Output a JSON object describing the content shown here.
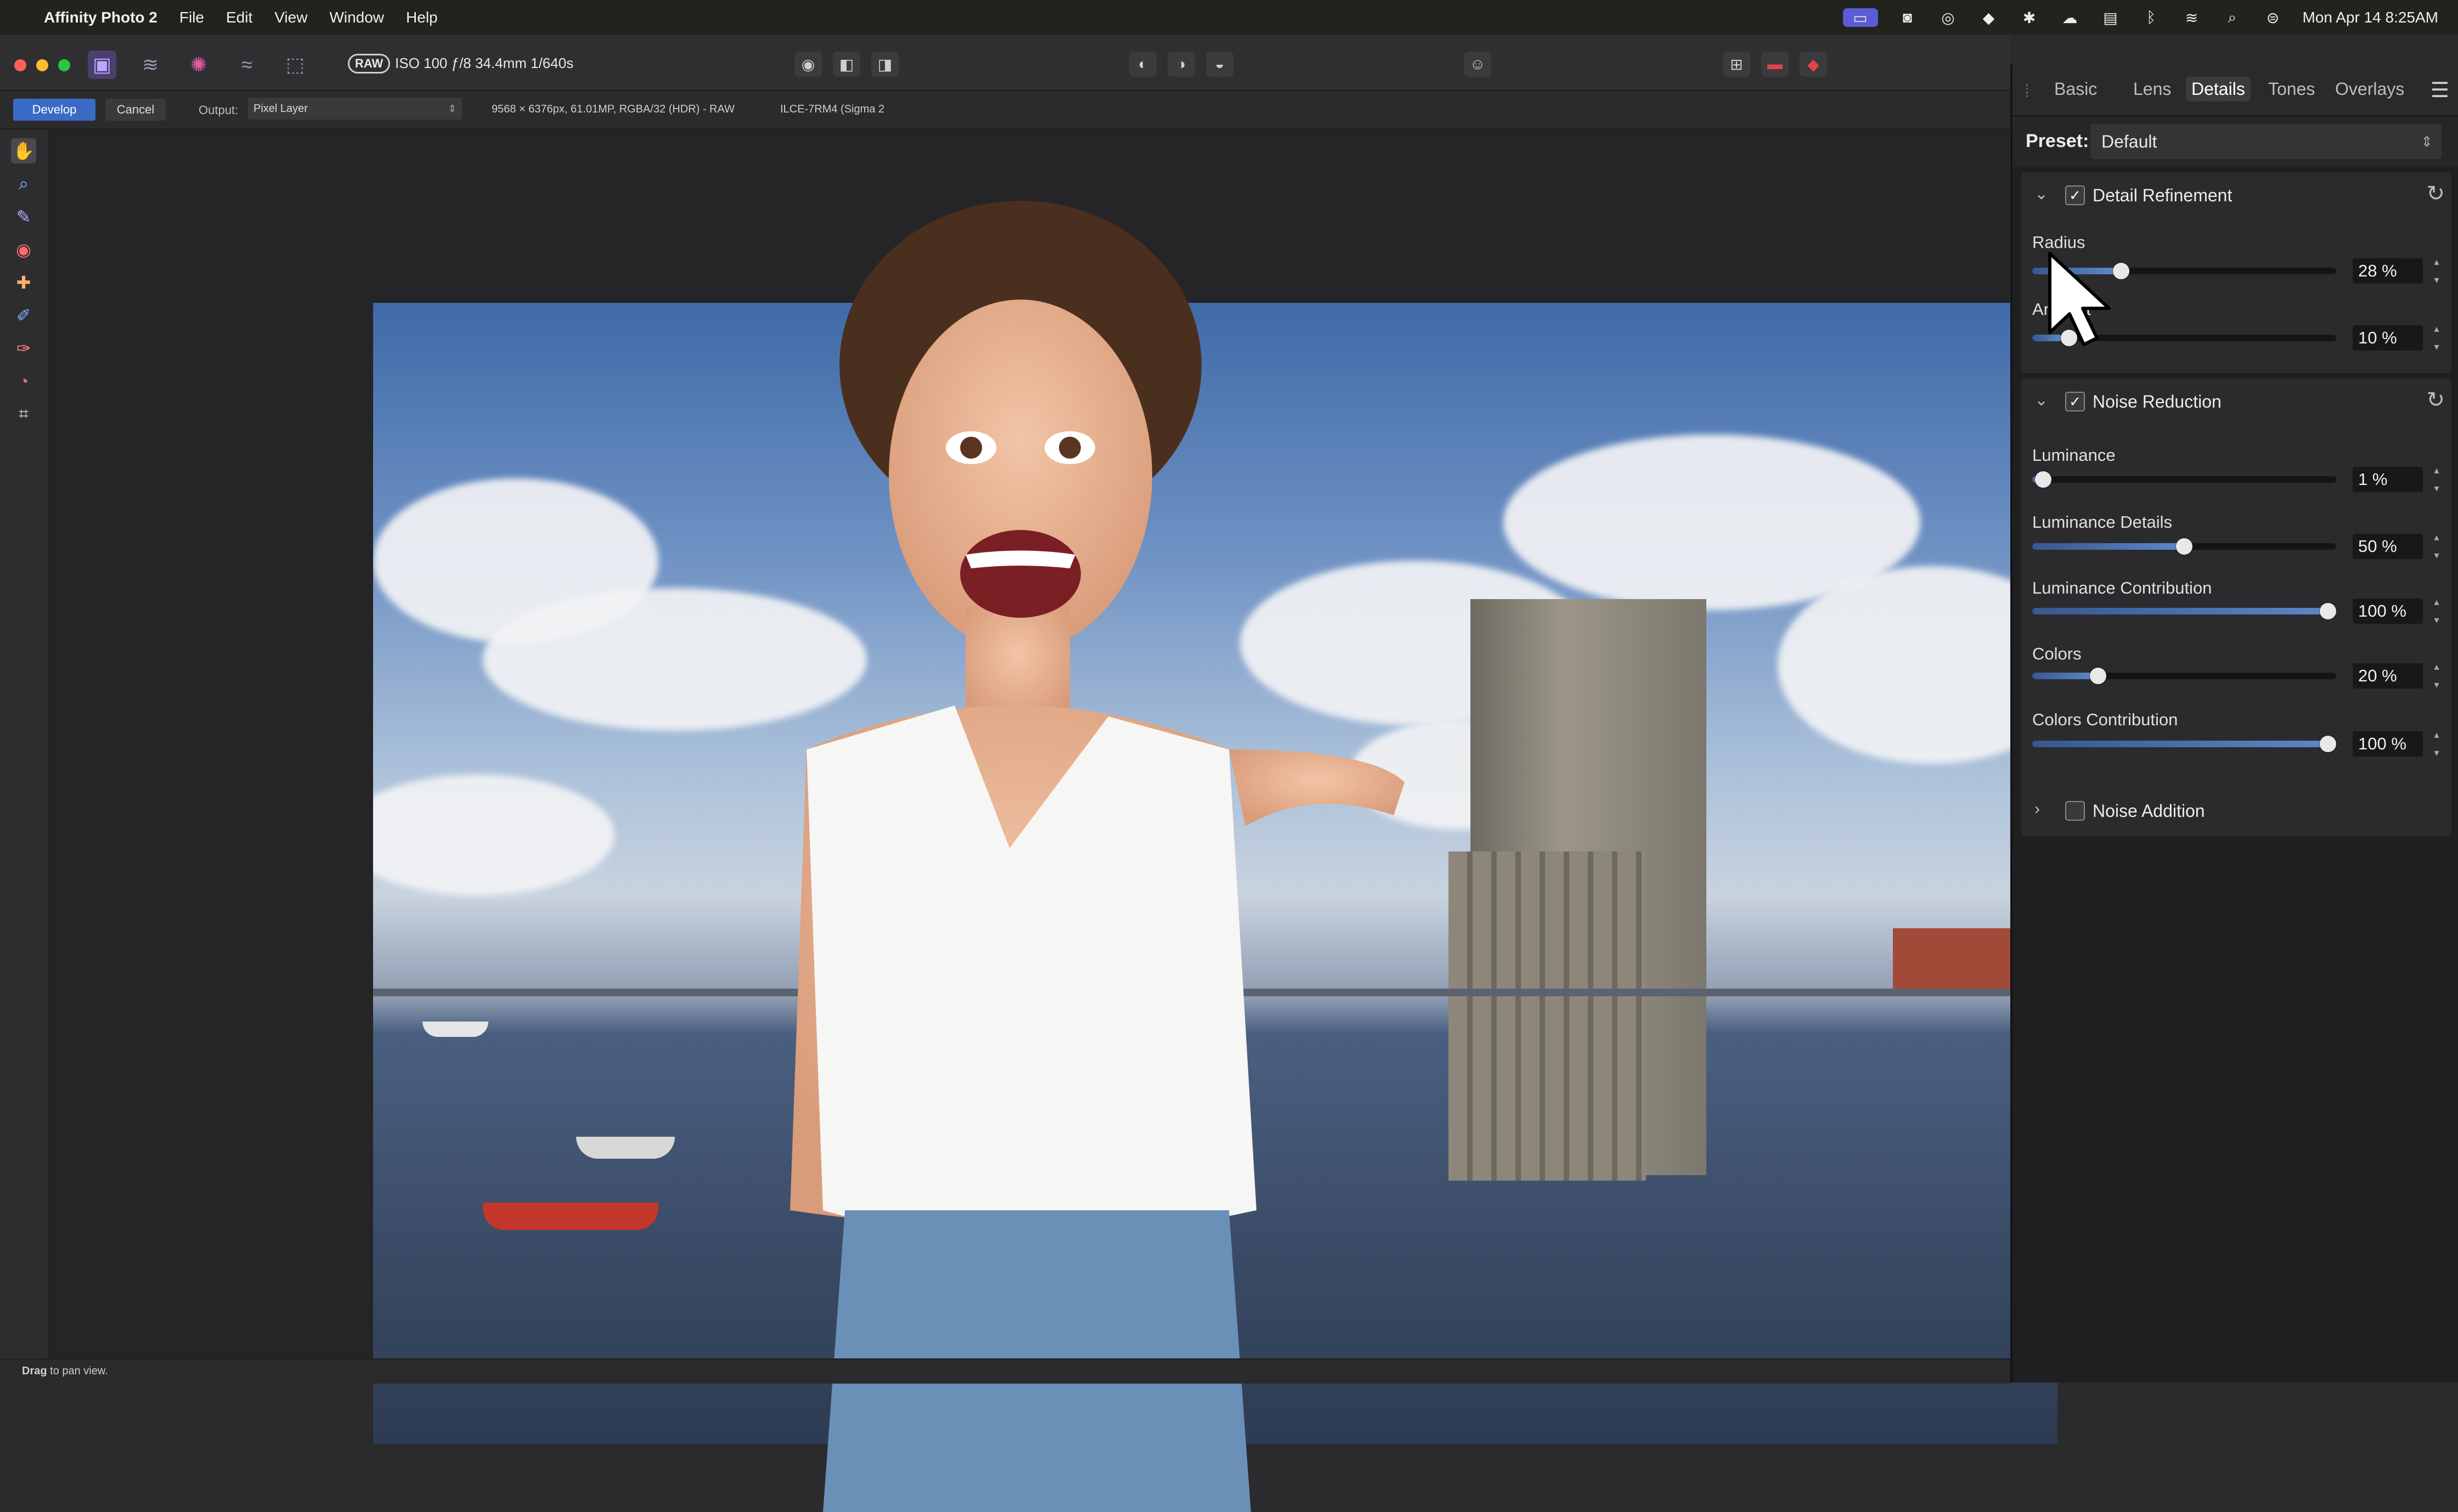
{
  "menubar": {
    "app_name": "Affinity Photo 2",
    "menus": [
      "File",
      "Edit",
      "View",
      "Window",
      "Help"
    ],
    "clock": "Mon Apr 14  8:25AM"
  },
  "toolbar": {
    "raw_badge": "RAW",
    "exif": "ISO 100 ƒ/8 34.4mm 1/640s"
  },
  "context": {
    "develop_label": "Develop",
    "cancel_label": "Cancel",
    "output_label": "Output:",
    "output_value": "Pixel Layer",
    "image_info": "9568 × 6376px, 61.01MP, RGBA/32 (HDR) - RAW",
    "camera_info": "ILCE-7RM4 (Sigma 2"
  },
  "statusbar": {
    "hint_bold": "Drag",
    "hint_rest": " to pan view."
  },
  "panel": {
    "tabs": [
      "Basic",
      "Lens",
      "Details",
      "Tones",
      "Overlays"
    ],
    "active_tab": "Details",
    "preset_label": "Preset:",
    "preset_value": "Default",
    "sections": {
      "detail_refinement": {
        "title": "Detail Refinement",
        "enabled": true,
        "controls": [
          {
            "label": "Radius",
            "value_text": "28 %",
            "value": 28
          },
          {
            "label": "Amount",
            "value_text": "10 %",
            "value": 10
          }
        ]
      },
      "noise_reduction": {
        "title": "Noise Reduction",
        "enabled": true,
        "controls": [
          {
            "label": "Luminance",
            "value_text": "1 %",
            "value": 1
          },
          {
            "label": "Luminance Details",
            "value_text": "50 %",
            "value": 50
          },
          {
            "label": "Luminance Contribution",
            "value_text": "100 %",
            "value": 100
          },
          {
            "label": "Colors",
            "value_text": "20 %",
            "value": 20
          },
          {
            "label": "Colors Contribution",
            "value_text": "100 %",
            "value": 100
          }
        ]
      },
      "noise_addition": {
        "title": "Noise Addition",
        "enabled": false
      }
    }
  },
  "colors": {
    "accent": "#3a6bc4",
    "slider_fill": "#5f87c8",
    "panel_bg": "#1f1f21"
  }
}
